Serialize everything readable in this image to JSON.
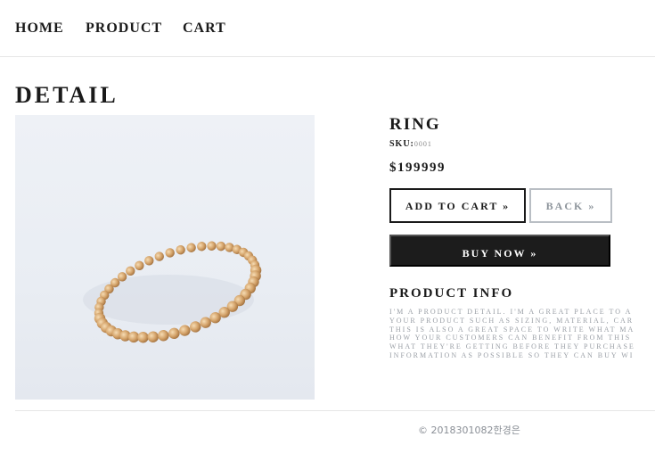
{
  "nav": {
    "items": [
      {
        "label": "HOME"
      },
      {
        "label": "PRODUCT"
      },
      {
        "label": "CART"
      }
    ]
  },
  "page_title": "DETAIL",
  "product": {
    "image": {
      "depicts": "ring-photo"
    },
    "name": "RING",
    "sku_label": "SKU:",
    "sku_value": "0001",
    "price": "$199999",
    "buttons": {
      "add_to_cart": "ADD TO CART »",
      "back": "BACK »",
      "buy_now": "BUY NOW »"
    },
    "info_title": "PRODUCT INFO",
    "info_lines": [
      "I'M A PRODUCT DETAIL. I'M A GREAT PLACE TO A",
      "YOUR PRODUCT SUCH AS SIZING, MATERIAL, CAR",
      "THIS IS ALSO A GREAT SPACE TO WRITE WHAT MA",
      "HOW YOUR CUSTOMERS CAN BENEFIT FROM THIS",
      "WHAT THEY'RE GETTING BEFORE THEY PURCHASE",
      "INFORMATION AS POSSIBLE SO THEY CAN BUY WI"
    ]
  },
  "footer": {
    "text": "© 2018301082한경은"
  },
  "colors": {
    "text": "#1a1a1a",
    "muted": "#9a9fa6",
    "buy_now_bg": "#1c1c1c",
    "ring_gold": "#d4a36a"
  }
}
